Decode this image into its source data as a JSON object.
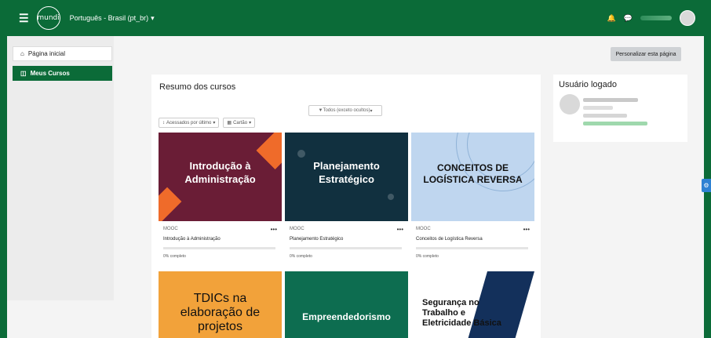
{
  "topbar": {
    "menu_icon": "hamburger-icon",
    "logo_text": "mundi",
    "language": "Português - Brasil (pt_br)",
    "language_caret": "▾",
    "bell_icon": "bell-icon",
    "chat_icon": "chat-icon",
    "avatar_icon": "user-avatar-icon"
  },
  "drawer": {
    "items": [
      {
        "label": "Página inicial",
        "icon": "home-icon"
      },
      {
        "label": "Meus Cursos",
        "icon": "courses-icon"
      }
    ]
  },
  "page": {
    "personalize": "Personalizar esta página"
  },
  "summary": {
    "title": "Resumo dos cursos",
    "filter_label": "Todos (exceto ocultos)",
    "sort_label": "Acessados por último",
    "view_label": "Cartão",
    "caret": "▾"
  },
  "courses": [
    {
      "banner_text": "Introdução à Administração",
      "category": "MOOC",
      "name": "Introdução à Administração",
      "progress_label": "0% completo",
      "progress": 0
    },
    {
      "banner_text": "Planejamento Estratégico",
      "category": "MOOC",
      "name": "Planejamento Estratégico",
      "progress_label": "0% completo",
      "progress": 0
    },
    {
      "banner_text": "CONCEITOS DE LOGÍSTICA REVERSA",
      "category": "MOOC",
      "name": "Conceitos de Logística Reversa",
      "progress_label": "0% completo",
      "progress": 0
    },
    {
      "banner_text": "TDICs na elaboração de projetos"
    },
    {
      "banner_text": "Empreendedorismo"
    },
    {
      "banner_text": "Segurança no Trabalho e Eletricidade Básica"
    }
  ],
  "user_panel": {
    "title": "Usuário logado"
  },
  "colors": {
    "brand_green": "#0b6b38",
    "card1": "#6a1d36",
    "card2": "#11303f",
    "card3": "#bfd6ef",
    "card4": "#f2a23a",
    "card5": "#0d6d50",
    "card6": "#ffffff"
  }
}
